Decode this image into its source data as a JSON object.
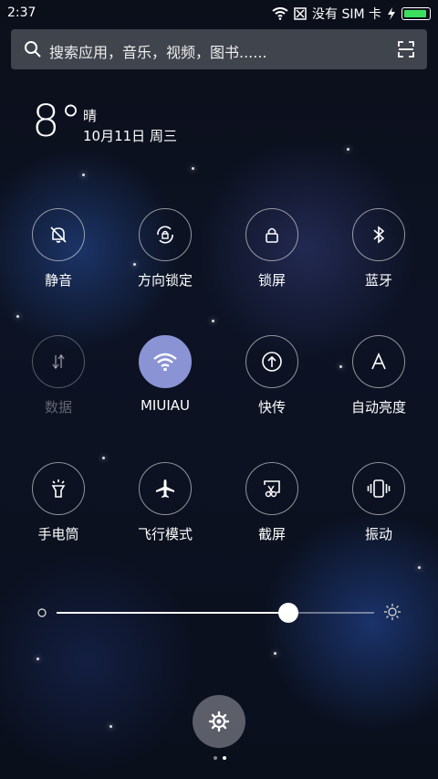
{
  "status_bar": {
    "time": "2:37",
    "carrier_text": "没有 SIM 卡",
    "battery_level": 0.9,
    "battery_color": "#3ae05d"
  },
  "search": {
    "placeholder": "搜索应用，音乐，视频，图书......",
    "search_icon": "search-icon",
    "scan_icon": "scan-icon"
  },
  "weather": {
    "temperature": "8°",
    "condition": "晴",
    "date": "10月11日 周三"
  },
  "toggles": [
    {
      "id": "mute",
      "label": "静音",
      "icon": "bell-off-icon",
      "active": false,
      "disabled": false
    },
    {
      "id": "rotation",
      "label": "方向锁定",
      "icon": "rotation-lock-icon",
      "active": false,
      "disabled": false
    },
    {
      "id": "lock",
      "label": "锁屏",
      "icon": "lock-icon",
      "active": false,
      "disabled": false
    },
    {
      "id": "bluetooth",
      "label": "蓝牙",
      "icon": "bluetooth-icon",
      "active": false,
      "disabled": false
    },
    {
      "id": "data",
      "label": "数据",
      "icon": "data-arrows-icon",
      "active": false,
      "disabled": true
    },
    {
      "id": "wifi",
      "label": "MIUIAU",
      "icon": "wifi-icon",
      "active": true,
      "disabled": false
    },
    {
      "id": "quick_send",
      "label": "快传",
      "icon": "upload-icon",
      "active": false,
      "disabled": false
    },
    {
      "id": "auto_brightness",
      "label": "自动亮度",
      "icon": "auto-brightness-icon",
      "active": false,
      "disabled": false
    },
    {
      "id": "flashlight",
      "label": "手电筒",
      "icon": "flashlight-icon",
      "active": false,
      "disabled": false
    },
    {
      "id": "airplane",
      "label": "飞行模式",
      "icon": "airplane-icon",
      "active": false,
      "disabled": false
    },
    {
      "id": "screenshot",
      "label": "截屏",
      "icon": "screenshot-scissors-icon",
      "active": false,
      "disabled": false
    },
    {
      "id": "vibrate",
      "label": "振动",
      "icon": "vibrate-icon",
      "active": false,
      "disabled": false
    }
  ],
  "brightness": {
    "level": 0.73,
    "low_icon": "brightness-low-icon",
    "high_icon": "brightness-high-icon"
  },
  "settings_button": {
    "icon": "gear-icon"
  },
  "pager": {
    "count": 2,
    "current": 1
  }
}
